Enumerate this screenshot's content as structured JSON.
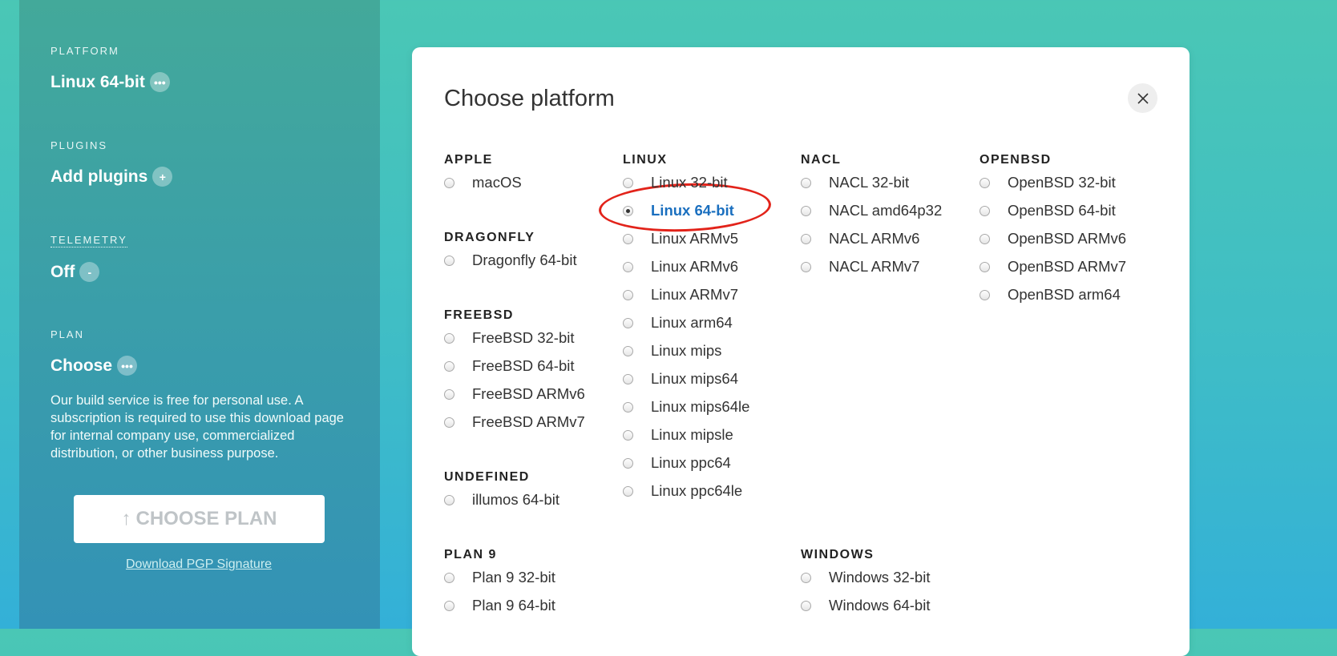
{
  "sidebar": {
    "platform_label": "PLATFORM",
    "platform_value": "Linux 64-bit",
    "platform_pill": "•••",
    "plugins_label": "PLUGINS",
    "plugins_value": "Add plugins",
    "plugins_pill": "+",
    "telemetry_label": "TELEMETRY",
    "telemetry_value": "Off",
    "telemetry_pill": "-",
    "plan_label": "PLAN",
    "plan_value": "Choose",
    "plan_pill": "•••",
    "plan_text": "Our build service is free for personal use. A subscription is required to use this download page for internal company use, commercialized distribution, or other business purpose.",
    "choose_plan_button": "CHOOSE PLAN",
    "choose_plan_arrow": "↑",
    "pgp_link": "Download PGP Signature"
  },
  "modal": {
    "title": "Choose platform",
    "groups": {
      "apple": {
        "title": "APPLE",
        "options": [
          "macOS"
        ]
      },
      "dragonfly": {
        "title": "DRAGONFLY",
        "options": [
          "Dragonfly 64-bit"
        ]
      },
      "freebsd": {
        "title": "FREEBSD",
        "options": [
          "FreeBSD 32-bit",
          "FreeBSD 64-bit",
          "FreeBSD ARMv6",
          "FreeBSD ARMv7"
        ]
      },
      "undefined": {
        "title": "UNDEFINED",
        "options": [
          "illumos 64-bit"
        ]
      },
      "plan9": {
        "title": "PLAN 9",
        "options": [
          "Plan 9 32-bit",
          "Plan 9 64-bit"
        ]
      },
      "linux": {
        "title": "LINUX",
        "options": [
          "Linux 32-bit",
          "Linux 64-bit",
          "Linux ARMv5",
          "Linux ARMv6",
          "Linux ARMv7",
          "Linux arm64",
          "Linux mips",
          "Linux mips64",
          "Linux mips64le",
          "Linux mipsle",
          "Linux ppc64",
          "Linux ppc64le"
        ]
      },
      "nacl": {
        "title": "NACL",
        "options": [
          "NACL 32-bit",
          "NACL amd64p32",
          "NACL ARMv6",
          "NACL ARMv7"
        ]
      },
      "windows": {
        "title": "WINDOWS",
        "options": [
          "Windows 32-bit",
          "Windows 64-bit"
        ]
      },
      "openbsd": {
        "title": "OPENBSD",
        "options": [
          "OpenBSD 32-bit",
          "OpenBSD 64-bit",
          "OpenBSD ARMv6",
          "OpenBSD ARMv7",
          "OpenBSD arm64"
        ]
      }
    },
    "selected": "Linux 64-bit"
  },
  "colors": {
    "accent": "#1a6fbf",
    "annotation": "#e2231a"
  }
}
